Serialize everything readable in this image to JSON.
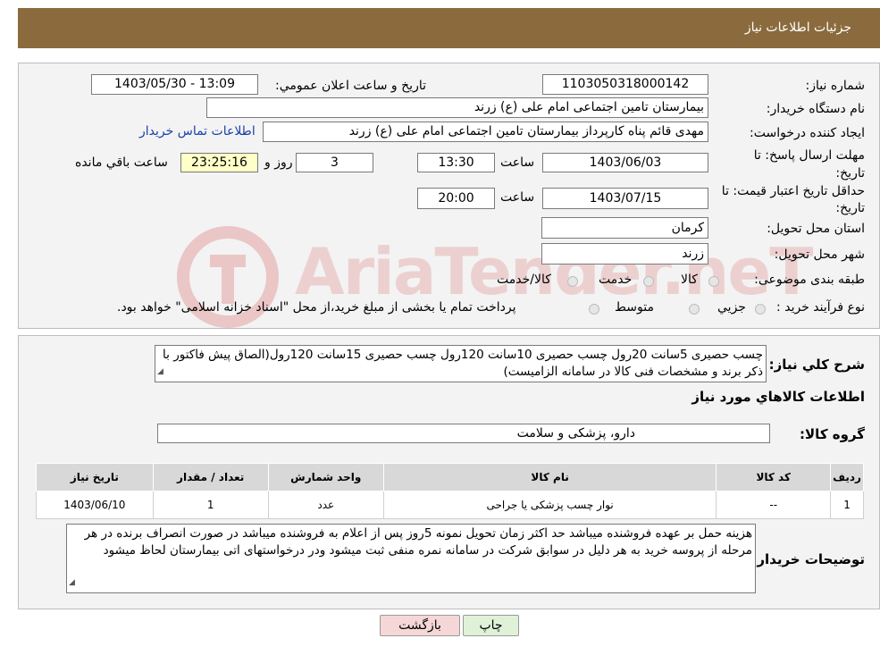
{
  "header": {
    "title": "جزئيات اطلاعات نياز"
  },
  "form": {
    "need_number_label": "شماره نياز:",
    "need_number": "1103050318000142",
    "announce_label": "تاريخ و ساعت اعلان عمومي:",
    "announce_value": "1403/05/30 - 13:09",
    "buyer_label": "نام دستگاه خريدار:",
    "buyer_value": "بيمارستان تامين اجتماعی امام علی (ع) زرند",
    "creator_label": "ايجاد کننده درخواست:",
    "creator_value": "مهدی  قائم پناه  کارپرداز بيمارستان تامين اجتماعی امام علی (ع) زرند",
    "contact_link": "اطلاعات تماس خريدار",
    "deadline_label": "مهلت ارسال پاسخ: تا تاريخ:",
    "deadline_date": "1403/06/03",
    "time_label": "ساعت",
    "deadline_time": "13:30",
    "days_value": "3",
    "days_label": "روز و",
    "remaining_value": "23:25:16",
    "remaining_label": "ساعت باقي مانده",
    "validity_label": "حداقل تاريخ اعتبار قيمت: تا تاريخ:",
    "validity_date": "1403/07/15",
    "validity_time": "20:00",
    "province_label": "استان محل تحويل:",
    "province_value": "کرمان",
    "city_label": "شهر محل تحويل:",
    "city_value": "زرند",
    "category_label": "طبقه بندی موضوعی:",
    "category_options": [
      "کالا",
      "خدمت",
      "کالا/خدمت"
    ],
    "process_label": "نوع فرآيند خريد :",
    "process_options": [
      "جزيي",
      "متوسط"
    ],
    "process_note": "پرداخت تمام يا بخشی از مبلغ خريد،از محل \"اسناد خزانه اسلامی\" خواهد بود."
  },
  "details": {
    "summary_label": "شرح کلي نياز:",
    "summary_text": "چسب حصيری 5سانت 20رول چسب حصيری 10سانت 120رول چسب حصيری 15سانت 120رول(الصاق پيش فاکتور با ذکر برند و مشخصات فنی کالا در سامانه الزاميست)",
    "goods_info_title": "اطلاعات کالاهاي مورد نياز",
    "group_label": "گروه کالا:",
    "group_value": "دارو، پزشکی و سلامت",
    "table": {
      "headers": [
        "رديف",
        "کد کالا",
        "نام کالا",
        "واحد شمارش",
        "تعداد / مقدار",
        "تاريخ نياز"
      ],
      "rows": [
        [
          "1",
          "--",
          "نوار چسب پزشکی يا جراحی",
          "عدد",
          "1",
          "1403/06/10"
        ]
      ]
    },
    "buyer_notes_label": "توضيحات خريدار:",
    "buyer_notes": "هزينه حمل بر عهده فروشنده ميباشد حد اکثر زمان تحويل نمونه 5روز پس از اعلام به فروشنده ميباشد در صورت انصراف برنده در هر مرحله از پروسه خريد به هر دليل در سوابق شرکت در سامانه نمره منفی ثبت ميشود ودر درخواستهای اتی بيمارستان لحاظ ميشود"
  },
  "buttons": {
    "back": "بازگشت",
    "print": "چاپ"
  },
  "watermark": {
    "text": "AriaTender.neT"
  },
  "colors": {
    "header_bg": "#8b6b3d",
    "yellow_field": "#ffffc8",
    "link": "#1a3fa8",
    "back_button": "#f6d7d7",
    "print_button": "#dff2d8"
  }
}
